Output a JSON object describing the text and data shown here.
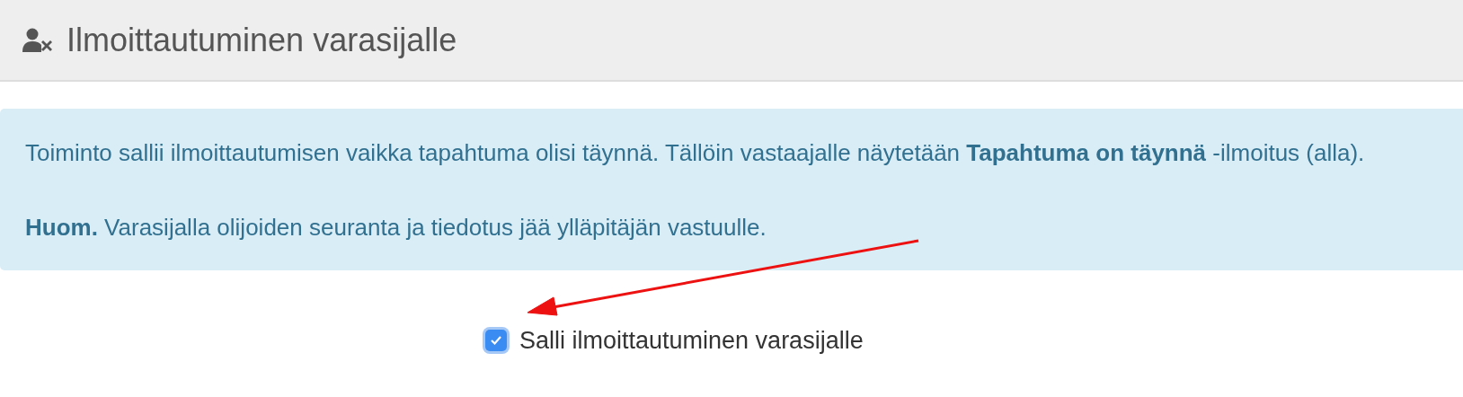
{
  "header": {
    "title": "Ilmoittautuminen varasijalle"
  },
  "notice": {
    "paragraphs": [
      "Toiminto sallii ilmoittautumisen vaikka tapahtuma olisi täynnä. Tällöin vastaajalle näytetään **Tapahtuma on täynnä** -ilmoitus (alla).",
      "**Huom.** Varasijalla olijoiden seuranta ja tiedotus jää ylläpitäjän vastuulle."
    ]
  },
  "option": {
    "label": "Salli ilmoittautuminen varasijalle",
    "checked": true
  }
}
